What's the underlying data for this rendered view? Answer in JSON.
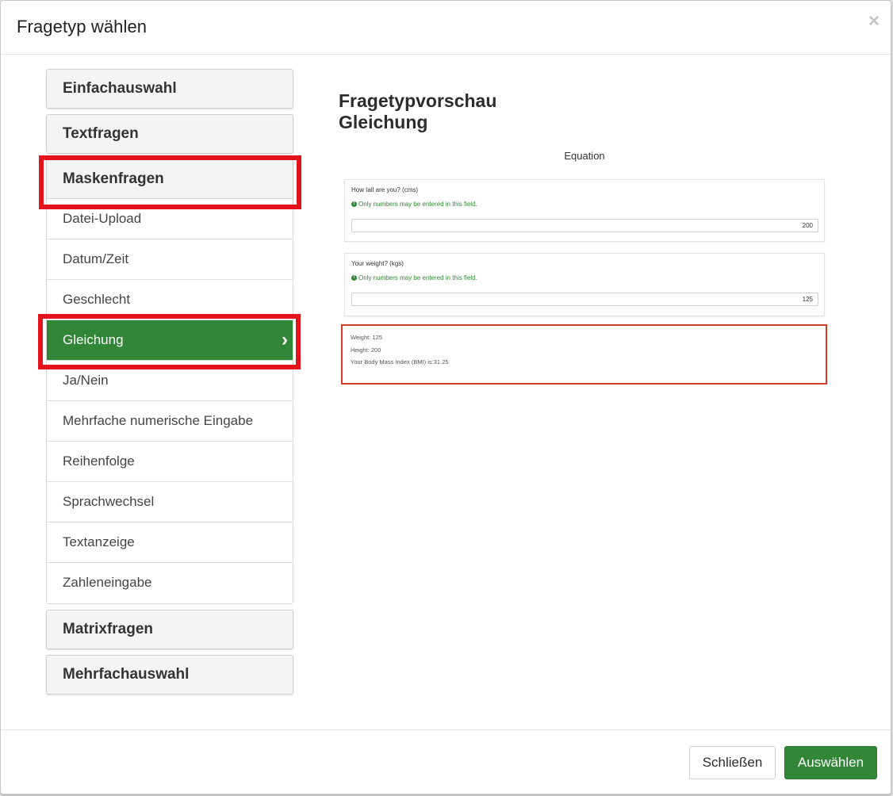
{
  "dialog": {
    "title": "Fragetyp wählen",
    "close_symbol": "×"
  },
  "groups": [
    {
      "label": "Einfachauswahl"
    },
    {
      "label": "Textfragen"
    },
    {
      "label": "Maskenfragen"
    },
    {
      "label": "Matrixfragen"
    },
    {
      "label": "Mehrfachauswahl"
    }
  ],
  "mask_items": [
    {
      "label": "Datei-Upload"
    },
    {
      "label": "Datum/Zeit"
    },
    {
      "label": "Geschlecht"
    },
    {
      "label": "Gleichung",
      "selected": true
    },
    {
      "label": "Ja/Nein"
    },
    {
      "label": "Mehrfache numerische Eingabe"
    },
    {
      "label": "Reihenfolge"
    },
    {
      "label": "Sprachwechsel"
    },
    {
      "label": "Textanzeige"
    },
    {
      "label": "Zahleneingabe"
    }
  ],
  "preview": {
    "heading_line1": "Fragetypvorschau",
    "heading_line2": "Gleichung",
    "frame_label": "Equation",
    "questions": [
      {
        "text": "How tall are you? (cms)",
        "hint": "Only numbers may be entered in this field.",
        "value": "200"
      },
      {
        "text": "Your weight? (kgs)",
        "hint": "Only numbers may be entered in this field.",
        "value": "125"
      }
    ],
    "result_lines": [
      "Weight: 125",
      "Height: 200",
      "Your Body Mass Index (BMI) is:31.25"
    ]
  },
  "footer": {
    "close_label": "Schließen",
    "select_label": "Auswählen"
  },
  "colors": {
    "accent_green": "#328637",
    "highlight_red": "#e3121d"
  },
  "icons": {
    "close": "close-icon",
    "chevron": "chevron-right-icon",
    "info": "info-circle-icon"
  }
}
